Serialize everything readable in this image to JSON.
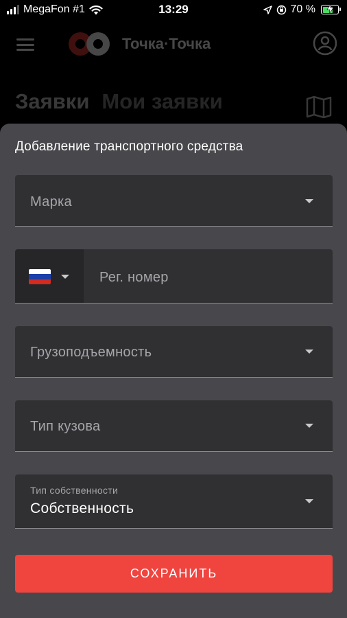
{
  "status_bar": {
    "carrier": "MegaFon #1",
    "time": "13:29",
    "battery_percent": "70 %",
    "battery_level": 0.7,
    "colors": {
      "battery_fill": "#4cd964"
    }
  },
  "header": {
    "brand_name": "Точка·Точка",
    "colors": {
      "logo_red": "#e53935"
    }
  },
  "tabs": [
    {
      "label": "Заявки"
    },
    {
      "label": "Мои заявки"
    }
  ],
  "sheet": {
    "title": "Добавление транспортного средства",
    "brand_field": {
      "placeholder": "Марка"
    },
    "reg_field": {
      "placeholder": "Рег. номер",
      "country_flag": "ru-flag-icon"
    },
    "capacity_field": {
      "placeholder": "Грузоподъемность"
    },
    "body_type_field": {
      "placeholder": "Тип кузова"
    },
    "ownership_field": {
      "label": "Тип собственности",
      "value": "Собственность"
    },
    "save_label": "СОХРАНИТЬ",
    "colors": {
      "accent": "#f0443f",
      "sheet_bg": "#48484c",
      "field_bg": "#303033"
    }
  }
}
